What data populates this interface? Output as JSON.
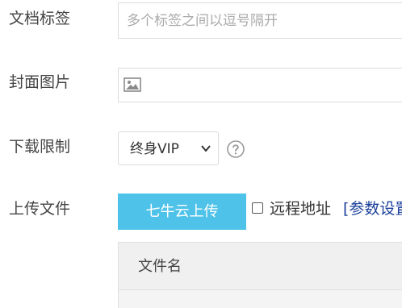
{
  "form": {
    "tags": {
      "label": "文档标签",
      "placeholder": "多个标签之间以逗号隔开",
      "value": ""
    },
    "cover": {
      "label": "封面图片",
      "icon": "image-icon"
    },
    "limit": {
      "label": "下载限制",
      "selected": "终身VIP",
      "help_icon": "question-circle-icon"
    },
    "upload": {
      "label": "上传文件",
      "button_label": "七牛云上传",
      "remote_label": "远程地址",
      "param_link": "[参数设置]"
    },
    "file_table": {
      "columns": [
        "文件名"
      ]
    }
  },
  "colors": {
    "upload_button": "#4ec2e8",
    "link": "#1a3e9a",
    "border": "#dcdcdc",
    "table_header": "#f0f0f0"
  }
}
